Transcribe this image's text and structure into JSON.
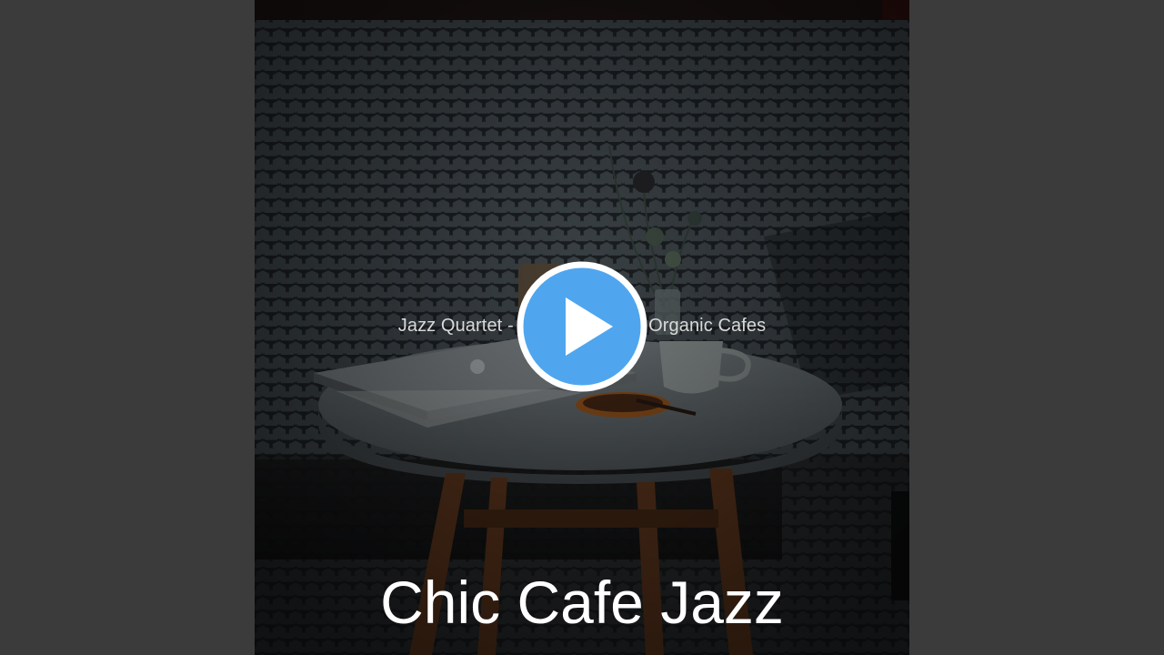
{
  "video": {
    "track_title": "Jazz Quartet - Background for Organic Cafes",
    "album_title": "Chic Cafe Jazz"
  },
  "player": {
    "play_icon": "play-icon",
    "accent_color": "#4fa6ee"
  },
  "colors": {
    "page_background": "#3b3b3b",
    "tile_wall": "#2c3135",
    "album_text": "#ffffff"
  }
}
